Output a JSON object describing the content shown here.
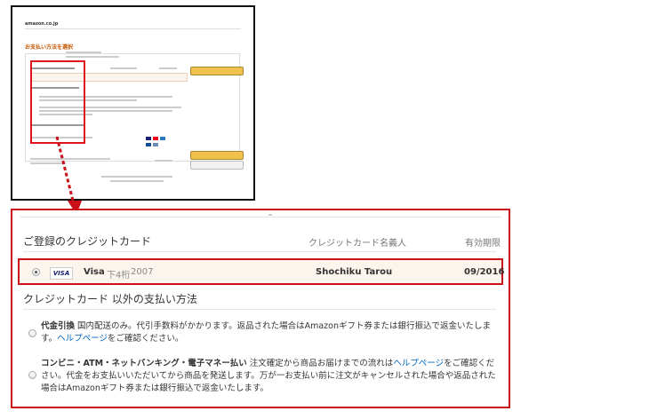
{
  "thumbnail": {
    "logo": "amazon.co.jp",
    "title": "お支払い方法を選択"
  },
  "panel": {
    "registered_cards_header": "ご登録のクレジットカード",
    "col_cardholder": "クレジットカード名義人",
    "col_expiry": "有効期限",
    "card": {
      "brand_logo": "VISA",
      "brand": "Visa",
      "last4_label": "下4桁",
      "last4": "2007",
      "holder": "Shochiku Tarou",
      "expiry": "09/2016",
      "selected": true
    },
    "other_methods_header": "クレジットカード 以外の支払い方法",
    "cod": {
      "title": "代金引換",
      "text_1": " 国内配送のみ。代引手数料がかかります。返品された場合はAmazonギフト券または銀行振込で返金いたします。",
      "link": "ヘルプページ",
      "text_2": "をご確認ください。"
    },
    "convenience": {
      "title": "コンビニ・ATM・ネットバンキング・電子マネー払い",
      "text_1": " 注文確定から商品お届けまでの流れは",
      "link": "ヘルプページ",
      "text_2": "をご確認ください。代金をお支払いいただいてから商品を発送します。万が一お支払い前に注文がキャンセルされた場合や返品された場合はAmazonギフト券または銀行振込で返金いたします。"
    }
  },
  "colors": {
    "highlight_red": "#cc1019",
    "row_bg": "#fcf5ee",
    "link_blue": "#0066c0",
    "button_yellow": "#f0c14b"
  }
}
